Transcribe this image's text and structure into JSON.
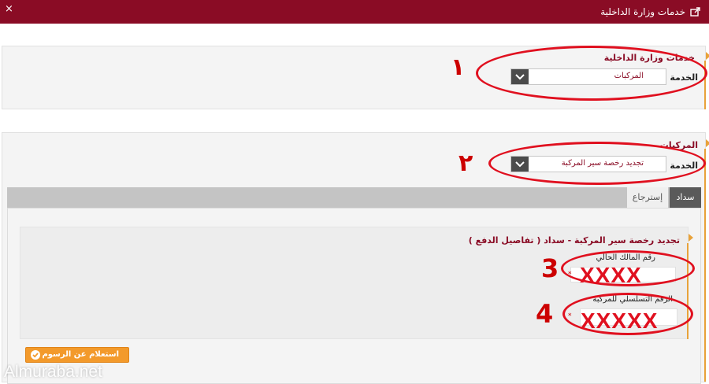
{
  "header": {
    "title": "خدمات وزارة الداخلية",
    "close_label": "×",
    "share_icon": "share-icon",
    "bg_color": "#8a0c25"
  },
  "ministry_panel": {
    "title": "خدمات وزارة الداخلية",
    "service_label": "الخدمة",
    "service_value": "المركبات",
    "step_number": "١"
  },
  "vehicles_panel": {
    "title": "المركبات",
    "service_label": "الخدمة",
    "service_value": "تجديد رخصة سير المركبة",
    "step_number": "٢"
  },
  "tabs": [
    {
      "label": "سداد",
      "active": true
    },
    {
      "label": "إسترجاع",
      "active": false
    }
  ],
  "form": {
    "title": "تجديد رخصة سير المركبة - سداد ( تفاصيل الدفع )",
    "owner_id_label": "رقم المالك الحالي",
    "owner_id_value": "XXXX",
    "owner_step": "3",
    "serial_label": "الرقم التسلسلي للمركبة",
    "serial_value": "XXXXX",
    "serial_step": "4",
    "required_mark": "*",
    "submit_label": "استعلام عن الرسوم"
  },
  "watermark": "Almuraba.net",
  "colors": {
    "accent": "#8a0c25",
    "orange": "#f39a2b",
    "annotation_red": "#e0101f"
  }
}
